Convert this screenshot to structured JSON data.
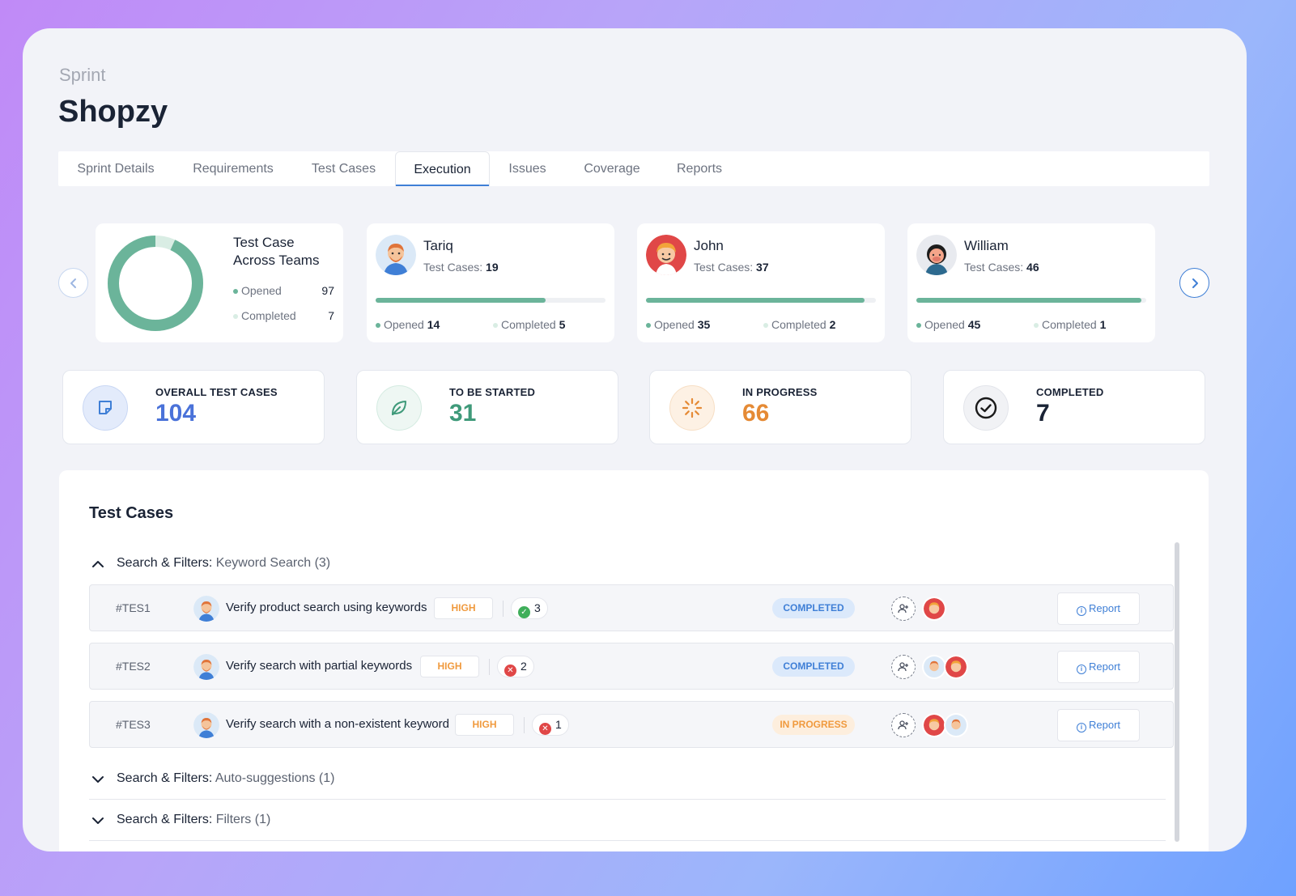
{
  "header": {
    "eyebrow": "Sprint",
    "title": "Shopzy"
  },
  "tabs": [
    {
      "label": "Sprint Details"
    },
    {
      "label": "Requirements"
    },
    {
      "label": "Test Cases"
    },
    {
      "label": "Execution",
      "active": true
    },
    {
      "label": "Issues"
    },
    {
      "label": "Coverage"
    },
    {
      "label": "Reports"
    }
  ],
  "summary": {
    "title": "Test Case Across Teams",
    "opened_label": "Opened",
    "opened_value": "97",
    "completed_label": "Completed",
    "completed_value": "7"
  },
  "members": [
    {
      "name": "Tariq",
      "tc_label": "Test Cases:",
      "tc_value": "19",
      "opened_label": "Opened",
      "opened": "14",
      "completed_label": "Completed",
      "completed": "5",
      "progress": 0.74,
      "avatar": "tariq-avatar"
    },
    {
      "name": "John",
      "tc_label": "Test Cases:",
      "tc_value": "37",
      "opened_label": "Opened",
      "opened": "35",
      "completed_label": "Completed",
      "completed": "2",
      "progress": 0.95,
      "avatar": "john-avatar"
    },
    {
      "name": "William",
      "tc_label": "Test Cases:",
      "tc_value": "46",
      "opened_label": "Opened",
      "opened": "45",
      "completed_label": "Completed",
      "completed": "1",
      "progress": 0.98,
      "avatar": "william-avatar"
    }
  ],
  "stats": [
    {
      "label": "OVERALL TEST CASES",
      "value": "104",
      "color": "#4a72d9",
      "icon": "note-icon"
    },
    {
      "label": "TO BE STARTED",
      "value": "31",
      "color": "#3f9a7a",
      "icon": "leaf-icon"
    },
    {
      "label": "IN PROGRESS",
      "value": "66",
      "color": "#e58a35",
      "icon": "loader-icon"
    },
    {
      "label": "COMPLETED",
      "value": "7",
      "color": "#1a2335",
      "icon": "check-circle-icon"
    }
  ],
  "panel": {
    "title": "Test Cases",
    "groups": [
      {
        "prefix": "Search & Filters:",
        "name": "Keyword Search",
        "count": "(3)",
        "expanded": true
      },
      {
        "prefix": "Search & Filters:",
        "name": "Auto-suggestions",
        "count": "(1)",
        "expanded": false
      },
      {
        "prefix": "Search & Filters:",
        "name": "Filters",
        "count": "(1)",
        "expanded": false
      }
    ],
    "rows": [
      {
        "id": "#TES1",
        "name": "Verify product search using keywords",
        "priority": "HIGH",
        "count": "3",
        "result": "pass",
        "status": "COMPLETED",
        "report": "Report"
      },
      {
        "id": "#TES2",
        "name": "Verify search with partial keywords",
        "priority": "HIGH",
        "count": "2",
        "result": "fail",
        "status": "COMPLETED",
        "report": "Report"
      },
      {
        "id": "#TES3",
        "name": "Verify search with a non-existent keyword",
        "priority": "HIGH",
        "count": "1",
        "result": "fail",
        "status": "IN PROGRESS",
        "report": "Report"
      }
    ]
  },
  "colors": {
    "accent": "#3f7fd6",
    "donut": "#6bb49a",
    "donut_light": "#d9ede4",
    "high": "#f09a3e",
    "pass": "#3fae5a",
    "fail": "#e04747"
  }
}
